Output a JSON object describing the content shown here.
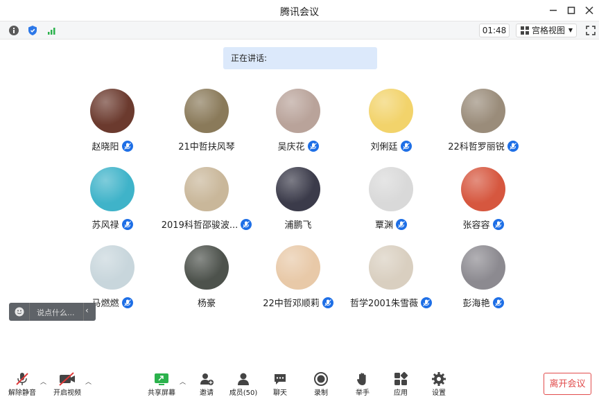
{
  "window": {
    "title": "腾讯会议"
  },
  "toolbar": {
    "timer": "01:48",
    "view_label": "宫格视图"
  },
  "speaking": {
    "label": "正在讲话:"
  },
  "participants": [
    {
      "name": "赵晓阳",
      "mic": true,
      "color": "#6b3a2e"
    },
    {
      "name": "21中哲扶风琴",
      "mic": false,
      "color": "#8a7a5a"
    },
    {
      "name": "吴庆花",
      "mic": true,
      "color": "#b9a39a"
    },
    {
      "name": "刘俐廷",
      "mic": true,
      "color": "#f2d36b"
    },
    {
      "name": "22科哲罗丽锐",
      "mic": true,
      "color": "#9a8c7a"
    },
    {
      "name": "苏风禄",
      "mic": true,
      "color": "#3fb3c9"
    },
    {
      "name": "2019科哲邵骏波...",
      "mic": true,
      "color": "#c9b79a"
    },
    {
      "name": "浦鹏飞",
      "mic": false,
      "color": "#3b3b4a"
    },
    {
      "name": "覃渊",
      "mic": true,
      "color": "#d9d9d9"
    },
    {
      "name": "张容容",
      "mic": true,
      "color": "#d6573f"
    },
    {
      "name": "马燃燃",
      "mic": true,
      "color": "#c8d6dc"
    },
    {
      "name": "杨豪",
      "mic": false,
      "color": "#4d524c"
    },
    {
      "name": "22中哲邓顺莉",
      "mic": true,
      "color": "#e8c9a8"
    },
    {
      "name": "哲学2001朱雪薇",
      "mic": true,
      "color": "#d9cfc0"
    },
    {
      "name": "彭海艳",
      "mic": true,
      "color": "#8c8a90"
    }
  ],
  "chat": {
    "placeholder": "说点什么..."
  },
  "bottom": {
    "unmute": "解除静音",
    "start_video": "开启视频",
    "share_screen": "共享屏幕",
    "invite": "邀请",
    "members": "成员(50)",
    "chat": "聊天",
    "record": "录制",
    "raise_hand": "举手",
    "apps": "应用",
    "settings": "设置",
    "leave": "离开会议"
  }
}
